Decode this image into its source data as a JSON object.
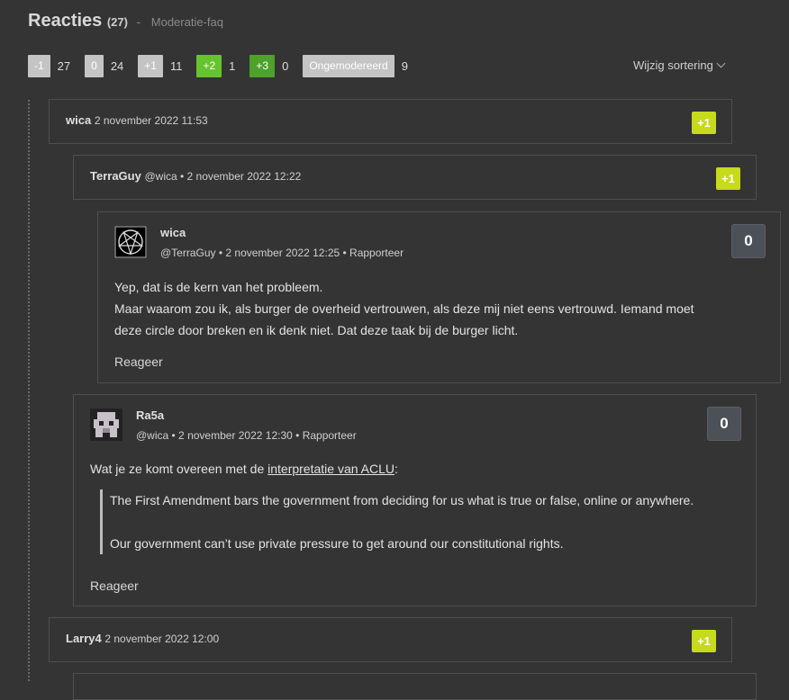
{
  "header": {
    "title": "Reacties",
    "count": "(27)",
    "separator": "-",
    "faq_link": "Moderatie-faq"
  },
  "filters": [
    {
      "label": "-1",
      "count": "27"
    },
    {
      "label": "0",
      "count": "24"
    },
    {
      "label": "+1",
      "count": "11"
    },
    {
      "label": "+2",
      "count": "1"
    },
    {
      "label": "+3",
      "count": "0"
    },
    {
      "label": "Ongemodereerd",
      "count": "9"
    }
  ],
  "sort_label": "Wijzig sortering",
  "comments": {
    "c1": {
      "user": "wica",
      "meta": "2 november 2022 11:53",
      "score": "+1"
    },
    "c2": {
      "user": "TerraGuy",
      "meta": "@wica • 2 november 2022 12:22",
      "score": "+1"
    },
    "c3": {
      "user": "wica",
      "meta": "@TerraGuy • 2 november 2022 12:25 • Rapporteer",
      "score": "0",
      "lines": [
        "Yep, dat is de kern van het probleem.",
        "Maar waarom zou ik, als burger de overheid vertrouwen, als deze mij niet eens vertrouwd. Iemand moet",
        "deze circle door breken en ik denk niet. Dat deze taak bij de burger licht."
      ],
      "reply": "Reageer"
    },
    "c4": {
      "user": "Ra5a",
      "meta": "@wica • 2 november 2022 12:30 • Rapporteer",
      "score": "0",
      "intro_prefix": "Wat je ze komt overeen met de ",
      "intro_link": "interpretatie van ACLU",
      "intro_suffix": ":",
      "quotes": [
        "The First Amendment bars the government from deciding for us what is true or false, online or anywhere.",
        "Our government can’t use private pressure to get around our constitutional rights."
      ],
      "reply": "Reageer"
    },
    "c5": {
      "user": "Larry4",
      "meta": "2 november 2022 12:00",
      "score": "+1"
    }
  },
  "colors": {
    "background": "#333433",
    "score_plus": "#c7da1b",
    "score_neutral": "#4c5057",
    "filter_plus2": "#66c42e",
    "filter_plus3": "#4ea12a"
  },
  "icons": {
    "sort_chevron": "chevron-down-icon",
    "avatar_wica": "pentagram-avatar",
    "avatar_ra5a": "pixel-robot-avatar"
  }
}
